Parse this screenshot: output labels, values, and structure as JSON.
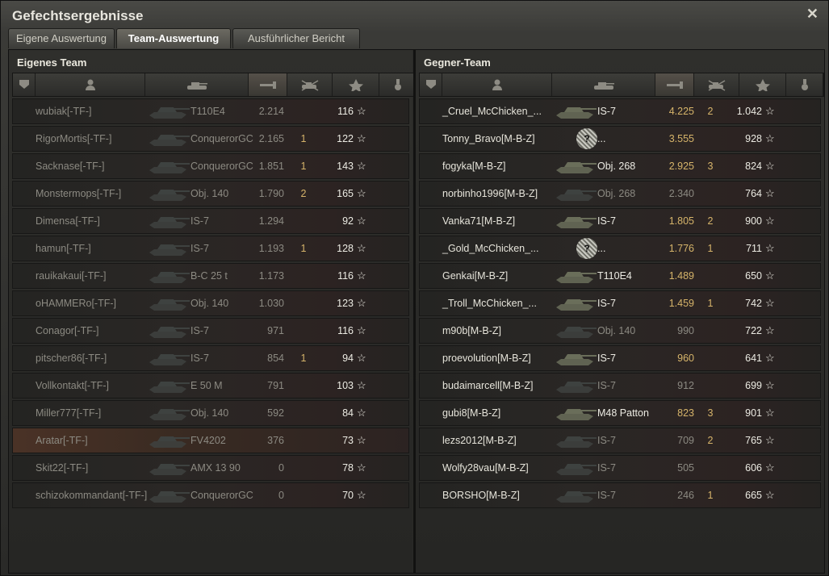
{
  "window": {
    "title": "Gefechtsergebnisse",
    "close_icon": "close-icon"
  },
  "tabs": [
    {
      "label": "Eigene Auswertung"
    },
    {
      "label": "Team-Auswertung"
    },
    {
      "label": "Ausführlicher Bericht"
    }
  ],
  "own_team": {
    "title": "Eigenes Team",
    "columns": [
      "rank-badge-icon",
      "player-icon",
      "tank-icon",
      "damage-icon",
      "kills-icon",
      "xp-star-icon",
      "medal-icon"
    ],
    "rows": [
      {
        "name": "wubiak[-TF-]",
        "tank": "T110E4",
        "damage": "2.214",
        "kills": "",
        "xp": "116",
        "star": "☆"
      },
      {
        "name": "RigorMortis[-TF-]",
        "tank": "ConquerorGC",
        "damage": "2.165",
        "kills": "1",
        "xp": "122",
        "star": "☆"
      },
      {
        "name": "Sacknase[-TF-]",
        "tank": "ConquerorGC",
        "damage": "1.851",
        "kills": "1",
        "xp": "143",
        "star": "☆"
      },
      {
        "name": "Monstermops[-TF-]",
        "tank": "Obj. 140",
        "damage": "1.790",
        "kills": "2",
        "xp": "165",
        "star": "☆"
      },
      {
        "name": "Dimensa[-TF-]",
        "tank": "IS-7",
        "damage": "1.294",
        "kills": "",
        "xp": "92",
        "star": "☆"
      },
      {
        "name": "hamun[-TF-]",
        "tank": "IS-7",
        "damage": "1.193",
        "kills": "1",
        "xp": "128",
        "star": "☆"
      },
      {
        "name": "rauikakaui[-TF-]",
        "tank": "B-C 25 t",
        "damage": "1.173",
        "kills": "",
        "xp": "116",
        "star": "☆"
      },
      {
        "name": "oHAMMERo[-TF-]",
        "tank": "Obj. 140",
        "damage": "1.030",
        "kills": "",
        "xp": "123",
        "star": "☆"
      },
      {
        "name": "Conagor[-TF-]",
        "tank": "IS-7",
        "damage": "971",
        "kills": "",
        "xp": "116",
        "star": "☆"
      },
      {
        "name": "pitscher86[-TF-]",
        "tank": "IS-7",
        "damage": "854",
        "kills": "1",
        "xp": "94",
        "star": "☆"
      },
      {
        "name": "Vollkontakt[-TF-]",
        "tank": "E 50 M",
        "damage": "791",
        "kills": "",
        "xp": "103",
        "star": "☆"
      },
      {
        "name": "Miller777[-TF-]",
        "tank": "Obj. 140",
        "damage": "592",
        "kills": "",
        "xp": "84",
        "star": "☆"
      },
      {
        "name": "Aratar[-TF-]",
        "tank": "FV4202",
        "damage": "376",
        "kills": "",
        "xp": "73",
        "star": "☆",
        "highlight": true
      },
      {
        "name": "Skit22[-TF-]",
        "tank": "AMX 13 90",
        "damage": "0",
        "kills": "",
        "xp": "78",
        "star": "☆"
      },
      {
        "name": "schizokommandant[-TF-]",
        "tank": "ConquerorGC",
        "damage": "0",
        "kills": "",
        "xp": "70",
        "star": "☆"
      }
    ]
  },
  "enemy_team": {
    "title": "Gegner-Team",
    "columns": [
      "rank-badge-icon",
      "player-icon",
      "tank-icon",
      "damage-icon",
      "kills-icon",
      "xp-star-icon",
      "medal-icon"
    ],
    "rows": [
      {
        "name": "_Cruel_McChicken_...",
        "tank": "IS-7",
        "damage": "4.225",
        "kills": "2",
        "xp": "1.042",
        "star": "☆",
        "alive": true
      },
      {
        "name": "Tonny_Bravo[M-B-Z]",
        "tank": "...",
        "damage": "3.555",
        "kills": "",
        "xp": "928",
        "star": "☆",
        "alive": true,
        "unknown": true
      },
      {
        "name": "fogyka[M-B-Z]",
        "tank": "Obj. 268",
        "damage": "2.925",
        "kills": "3",
        "xp": "824",
        "star": "☆",
        "alive": true
      },
      {
        "name": "norbinho1996[M-B-Z]",
        "tank": "Obj. 268",
        "damage": "2.340",
        "kills": "",
        "xp": "764",
        "star": "☆",
        "alive": false
      },
      {
        "name": "Vanka71[M-B-Z]",
        "tank": "IS-7",
        "damage": "1.805",
        "kills": "2",
        "xp": "900",
        "star": "☆",
        "alive": true
      },
      {
        "name": "_Gold_McChicken_...",
        "tank": "...",
        "damage": "1.776",
        "kills": "1",
        "xp": "711",
        "star": "☆",
        "alive": true,
        "unknown": true
      },
      {
        "name": "Genkai[M-B-Z]",
        "tank": "T110E4",
        "damage": "1.489",
        "kills": "",
        "xp": "650",
        "star": "☆",
        "alive": true
      },
      {
        "name": "_Troll_McChicken_...",
        "tank": "IS-7",
        "damage": "1.459",
        "kills": "1",
        "xp": "742",
        "star": "☆",
        "alive": true
      },
      {
        "name": "m90b[M-B-Z]",
        "tank": "Obj. 140",
        "damage": "990",
        "kills": "",
        "xp": "722",
        "star": "☆",
        "alive": false
      },
      {
        "name": "proevolution[M-B-Z]",
        "tank": "IS-7",
        "damage": "960",
        "kills": "",
        "xp": "641",
        "star": "☆",
        "alive": true
      },
      {
        "name": "budaimarcell[M-B-Z]",
        "tank": "IS-7",
        "damage": "912",
        "kills": "",
        "xp": "699",
        "star": "☆",
        "alive": false
      },
      {
        "name": "gubi8[M-B-Z]",
        "tank": "M48 Patton",
        "damage": "823",
        "kills": "3",
        "xp": "901",
        "star": "☆",
        "alive": true
      },
      {
        "name": "lezs2012[M-B-Z]",
        "tank": "IS-7",
        "damage": "709",
        "kills": "2",
        "xp": "765",
        "star": "☆",
        "alive": false
      },
      {
        "name": "Wolfy28vau[M-B-Z]",
        "tank": "IS-7",
        "damage": "505",
        "kills": "",
        "xp": "606",
        "star": "☆",
        "alive": false
      },
      {
        "name": "BORSHO[M-B-Z]",
        "tank": "IS-7",
        "damage": "246",
        "kills": "1",
        "xp": "665",
        "star": "☆",
        "alive": false
      }
    ]
  },
  "colors": {
    "gold": "#d6b46a",
    "dim": "#8c8a82",
    "bright": "#ecebe3",
    "highlight": "#4a3226"
  }
}
